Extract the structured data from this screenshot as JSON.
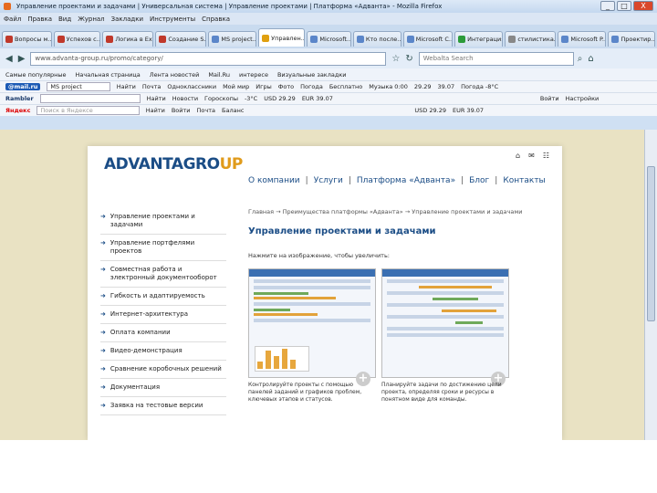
{
  "window": {
    "title": "Управление проектами и задачами | Универсальная система | Управление проектами | Платформа «Адванта» - Mozilla Firefox",
    "min": "_",
    "max": "□",
    "close": "X"
  },
  "menu": [
    "Файл",
    "Правка",
    "Вид",
    "Журнал",
    "Закладки",
    "Инструменты",
    "Справка"
  ],
  "tabs": [
    "Вопросы м...",
    "Успехов с...",
    "Логика в Ex...",
    "Создание S...",
    "MS project...",
    "Управлен...",
    "Microsoft...",
    "Кто после...",
    "Microsoft C...",
    "Интеграция",
    "стилистика...",
    "Microsoft P...",
    "Проектир..."
  ],
  "address": {
    "url": "www.advanta-group.ru/promo/category/",
    "search_placeholder": "Webalta Search"
  },
  "bookmarks": [
    "Самые популярные",
    "Начальная страница",
    "Лента новостей",
    "Mail.Ru",
    "интересе",
    "Визуальные закладки"
  ],
  "toolbar1": [
    "@mail.ru",
    "MS project",
    "Найти",
    "Почта",
    "Одноклассники",
    "Мой мир",
    "Игры",
    "Фото",
    "Погода",
    "Бесплатно",
    "Музыка 0:00",
    "29.29",
    "39.07",
    "Погода -8°C"
  ],
  "toolbar2": [
    "Rambler",
    "Найти",
    "Новости",
    "Гороскопы",
    "-3°C",
    "USD 29.29",
    "EUR 39.07",
    "Войти",
    "Настройки"
  ],
  "toolbar3": [
    "Яндекс",
    "Поиск в Яндексе",
    "Найти",
    "Войти",
    "Почта",
    "Баланс",
    "USD 29.29",
    "EUR 39.07"
  ],
  "site": {
    "logo_main": "ADVANTAGRO",
    "logo_sub": "UP",
    "nav": [
      "О компании",
      "Услуги",
      "Платформа «Адванта»",
      "Блог",
      "Контакты"
    ],
    "side": [
      "Управление проектами и задачами",
      "Управление портфелями проектов",
      "Совместная работа и электронный документооборот",
      "Гибкость и адаптируемость",
      "Интернет-архитектура",
      "Оплата компании",
      "Видео-демонстрация",
      "Сравнение коробочных решений",
      "Документация",
      "Заявка на тестовые версии"
    ],
    "crumbs": "Главная → Преимущества платформы «Адванта» → Управление проектами и задачами",
    "title": "Управление проектами и задачами",
    "hint": "Нажмите на изображение, чтобы увеличить:",
    "cap1": "Контролируйте проекты с помощью панелей заданий и графиков проблем, ключевых этапов и статусов.",
    "cap2": "Планируйте задачи по достижению цели проекта, определяя сроки и ресурсы в понятном виде для команды."
  },
  "colors": {
    "brand": "#1b4d86",
    "accent": "#e09b1b",
    "page_bg": "#e9e2c3"
  }
}
